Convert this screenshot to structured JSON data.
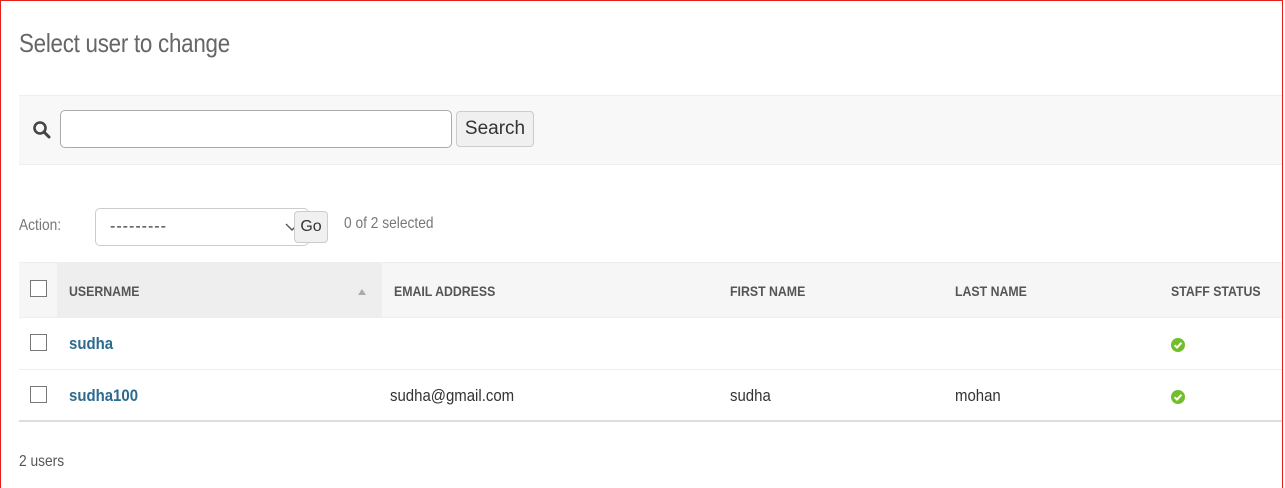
{
  "page": {
    "title": "Select user to change",
    "border_color": "#e8201c"
  },
  "search": {
    "value": "",
    "placeholder": "",
    "button_label": "Search",
    "icon": "search-icon"
  },
  "actions": {
    "label": "Action:",
    "selected_option": "---------",
    "go_label": "Go",
    "selected_count": "0 of 2 selected"
  },
  "table": {
    "columns": [
      "USERNAME",
      "EMAIL ADDRESS",
      "FIRST NAME",
      "LAST NAME",
      "STAFF STATUS"
    ],
    "sorted_column": "USERNAME",
    "rows": [
      {
        "username": "sudha",
        "email": "",
        "first_name": "",
        "last_name": "",
        "staff_status": true
      },
      {
        "username": "sudha100",
        "email": "sudha@gmail.com",
        "first_name": "sudha",
        "last_name": "mohan",
        "staff_status": true
      }
    ]
  },
  "footer": {
    "count_text": "2 users"
  },
  "colors": {
    "link": "#2b6b8c",
    "check_green": "#70bf2b"
  }
}
